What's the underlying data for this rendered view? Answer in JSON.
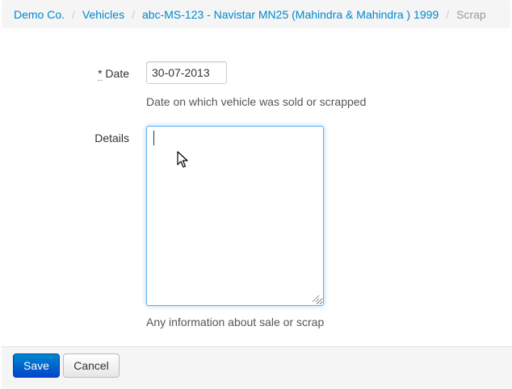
{
  "breadcrumb": {
    "items": [
      {
        "label": "Demo Co."
      },
      {
        "label": "Vehicles"
      },
      {
        "label": "abc-MS-123 - Navistar MN25 (Mahindra & Mahindra ) 1999"
      }
    ],
    "separator": "/",
    "active": "Scrap"
  },
  "form": {
    "date": {
      "required_mark": "*",
      "label": "Date",
      "value": "30-07-2013",
      "help": "Date on which vehicle was sold or scrapped"
    },
    "details": {
      "label": "Details",
      "value": "",
      "help": "Any information about sale or scrap"
    }
  },
  "actions": {
    "save_label": "Save",
    "cancel_label": "Cancel"
  },
  "colors": {
    "link": "#0088cc",
    "primary_button": "#0055cc",
    "focus_border": "#66afe9"
  }
}
